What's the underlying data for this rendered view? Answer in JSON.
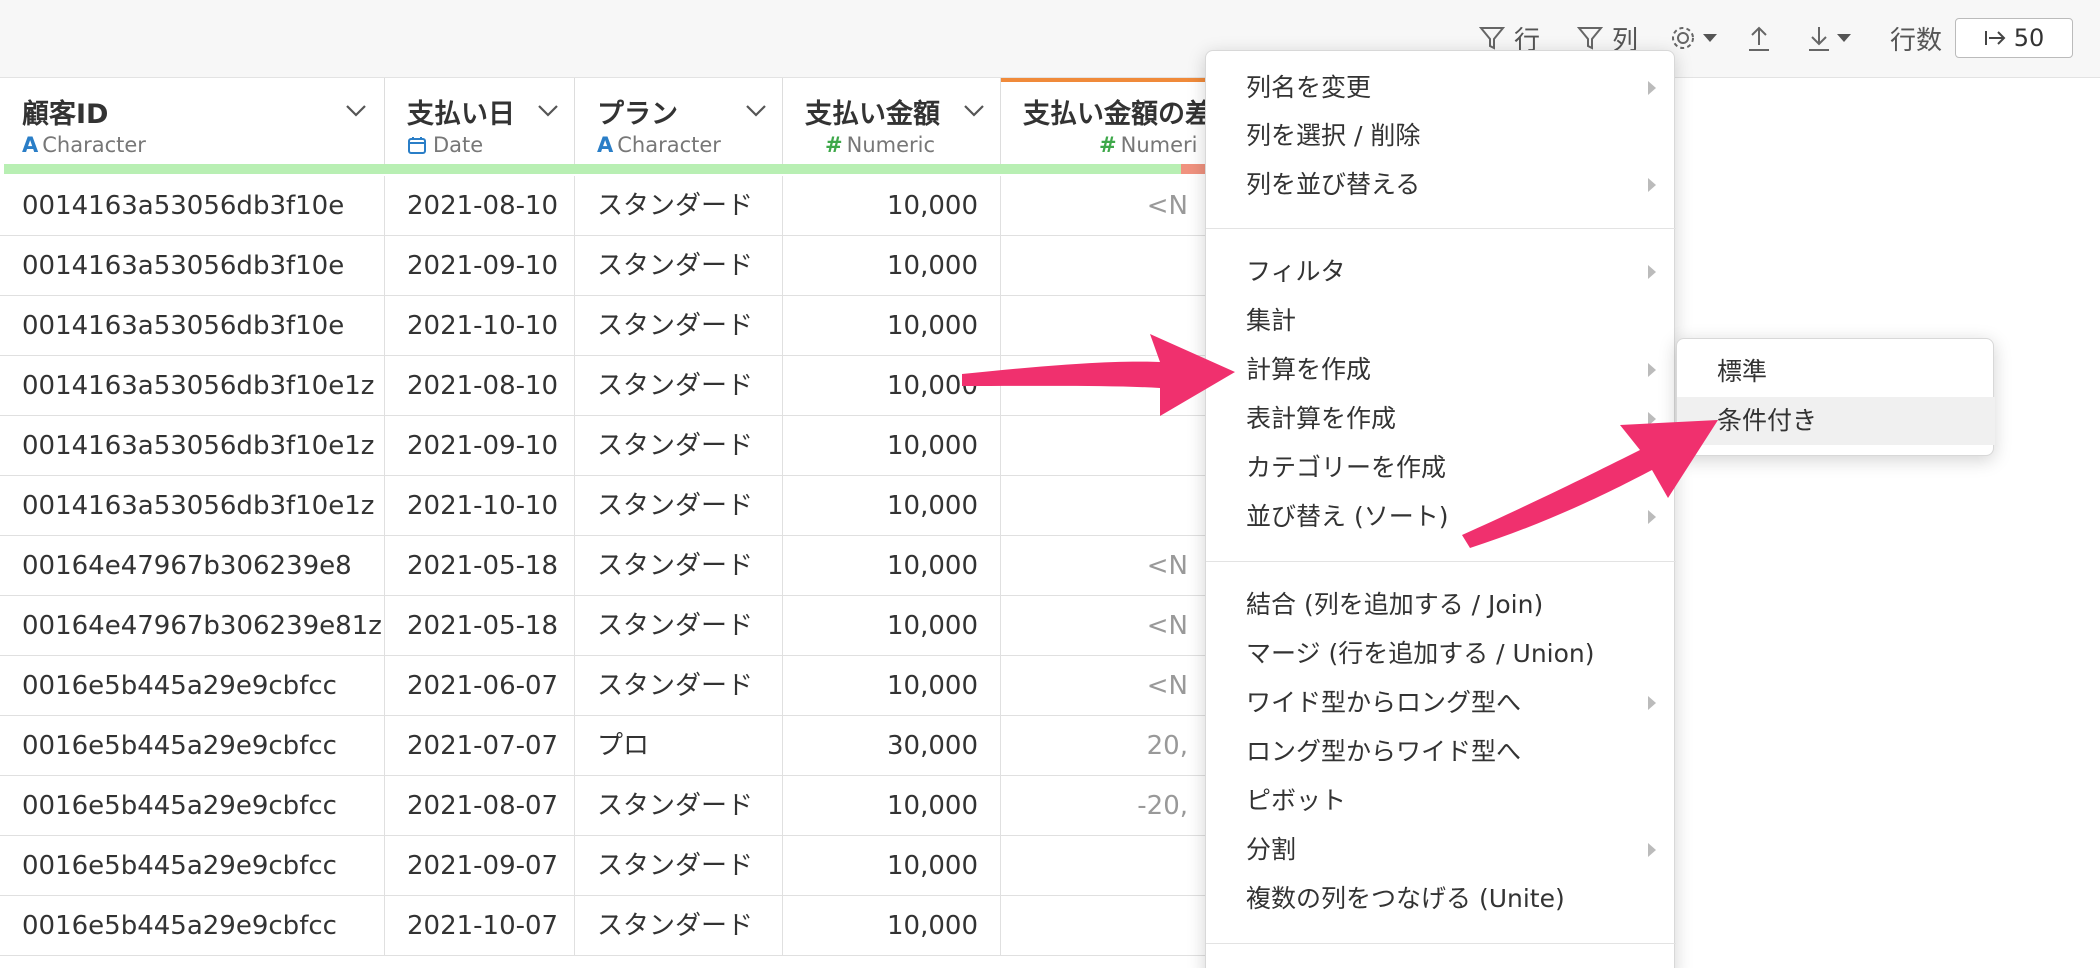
{
  "toolbar": {
    "row_filter_label": "行",
    "column_filter_label": "列",
    "rows_label": "行数",
    "rows_value": "50",
    "icons": [
      "filter-icon",
      "filter-icon",
      "gear-icon",
      "upload-icon",
      "download-icon",
      "arrow-right-icon"
    ]
  },
  "columns": [
    {
      "title": "顧客ID",
      "type_icon": "A",
      "type": "Character"
    },
    {
      "title": "支払い日",
      "type_icon": "calendar-icon",
      "type": "Date"
    },
    {
      "title": "プラン",
      "type_icon": "A",
      "type": "Character"
    },
    {
      "title": "支払い金額",
      "type_icon": "#",
      "type": "Numeric"
    },
    {
      "title": "支払い金額の差",
      "type_icon": "#",
      "type": "Numeri"
    }
  ],
  "rows": [
    [
      "0014163a53056db3f10e",
      "2021-08-10",
      "スタンダード",
      "10,000",
      "<N"
    ],
    [
      "0014163a53056db3f10e",
      "2021-09-10",
      "スタンダード",
      "10,000",
      ""
    ],
    [
      "0014163a53056db3f10e",
      "2021-10-10",
      "スタンダード",
      "10,000",
      ""
    ],
    [
      "0014163a53056db3f10e1z",
      "2021-08-10",
      "スタンダード",
      "10,000",
      ""
    ],
    [
      "0014163a53056db3f10e1z",
      "2021-09-10",
      "スタンダード",
      "10,000",
      ""
    ],
    [
      "0014163a53056db3f10e1z",
      "2021-10-10",
      "スタンダード",
      "10,000",
      ""
    ],
    [
      "00164e47967b306239e8",
      "2021-05-18",
      "スタンダード",
      "10,000",
      "<N"
    ],
    [
      "00164e47967b306239e81z",
      "2021-05-18",
      "スタンダード",
      "10,000",
      "<N"
    ],
    [
      "0016e5b445a29e9cbfcc",
      "2021-06-07",
      "スタンダード",
      "10,000",
      "<N"
    ],
    [
      "0016e5b445a29e9cbfcc",
      "2021-07-07",
      "プロ",
      "30,000",
      "20,"
    ],
    [
      "0016e5b445a29e9cbfcc",
      "2021-08-07",
      "スタンダード",
      "10,000",
      "-20,"
    ],
    [
      "0016e5b445a29e9cbfcc",
      "2021-09-07",
      "スタンダード",
      "10,000",
      ""
    ],
    [
      "0016e5b445a29e9cbfcc",
      "2021-10-07",
      "スタンダード",
      "10,000",
      ""
    ]
  ],
  "menu": {
    "items": [
      {
        "label": "列名を変更",
        "submenu": true
      },
      {
        "label": "列を選択 / 削除",
        "submenu": false
      },
      {
        "label": "列を並び替える",
        "submenu": true
      },
      {
        "label": "フィルタ",
        "submenu": true
      },
      {
        "label": "集計",
        "submenu": false
      },
      {
        "label": "計算を作成",
        "submenu": true
      },
      {
        "label": "表計算を作成",
        "submenu": true
      },
      {
        "label": "カテゴリーを作成",
        "submenu": false
      },
      {
        "label": "並び替え (ソート)",
        "submenu": true
      },
      {
        "label": "結合 (列を追加する / Join)",
        "submenu": false
      },
      {
        "label": "マージ (行を追加する / Union)",
        "submenu": false
      },
      {
        "label": "ワイド型からロング型へ",
        "submenu": true
      },
      {
        "label": "ロング型からワイド型へ",
        "submenu": false
      },
      {
        "label": "ピボット",
        "submenu": false
      },
      {
        "label": "分割",
        "submenu": true
      },
      {
        "label": "複数の列をつなげる (Unite)",
        "submenu": false
      }
    ]
  },
  "submenu": {
    "items": [
      {
        "label": "標準"
      },
      {
        "label": "条件付き"
      }
    ]
  },
  "colors": {
    "accent_arrow": "#f0306e",
    "quality_green": "#b8efb3",
    "quality_red": "#f0927f",
    "header_accent": "#f08a3a"
  }
}
